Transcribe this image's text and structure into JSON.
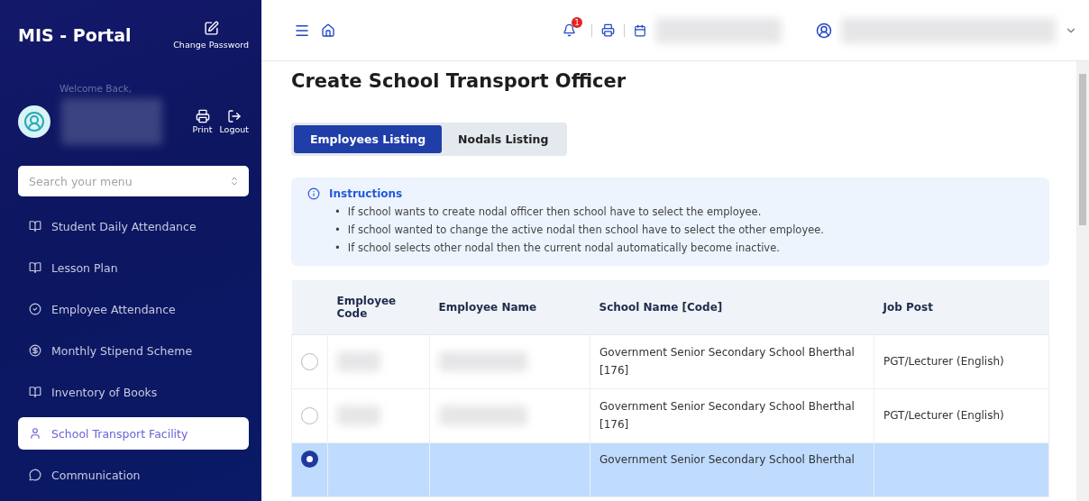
{
  "sidebar": {
    "brand": "MIS - Portal",
    "change_password": "Change Password",
    "welcome": "Welcome Back,",
    "actions": [
      {
        "kind": "print",
        "label": "Print"
      },
      {
        "kind": "logout",
        "label": "Logout"
      }
    ],
    "search": {
      "placeholder": "Search your menu"
    },
    "items": [
      {
        "label": "Student Daily Attendance",
        "selected": false
      },
      {
        "label": "Lesson Plan",
        "selected": false
      },
      {
        "label": "Employee Attendance",
        "selected": false
      },
      {
        "label": "Monthly Stipend Scheme",
        "selected": false
      },
      {
        "label": "Inventory of Books",
        "selected": false
      },
      {
        "label": "School Transport Facility",
        "selected": true
      },
      {
        "label": "Communication",
        "selected": false
      }
    ]
  },
  "header": {
    "notification_count": "1"
  },
  "page": {
    "title": "Create School Transport Officer",
    "tabs": [
      {
        "label": "Employees Listing",
        "selected": true
      },
      {
        "label": "Nodals Listing",
        "selected": false
      }
    ],
    "instructions": {
      "title": "Instructions",
      "bullet": "•",
      "items": [
        "If school wants to create nodal officer then school have to select the employee.",
        "If school wanted to change the active nodal then school have to select the other employee.",
        "If school selects other nodal then the current nodal automatically become inactive."
      ]
    },
    "table": {
      "columns": [
        "Employee Code",
        "Employee Name",
        "School Name [Code]",
        "Job Post"
      ],
      "rows": [
        {
          "selected": false,
          "school": "Government Senior Secondary School Bherthal [176]",
          "job_post": "PGT/Lecturer (English)"
        },
        {
          "selected": false,
          "school": "Government Senior Secondary School Bherthal [176]",
          "job_post": "PGT/Lecturer (English)"
        },
        {
          "selected": true,
          "school": "Government Senior Secondary School Bherthal"
        }
      ]
    }
  }
}
